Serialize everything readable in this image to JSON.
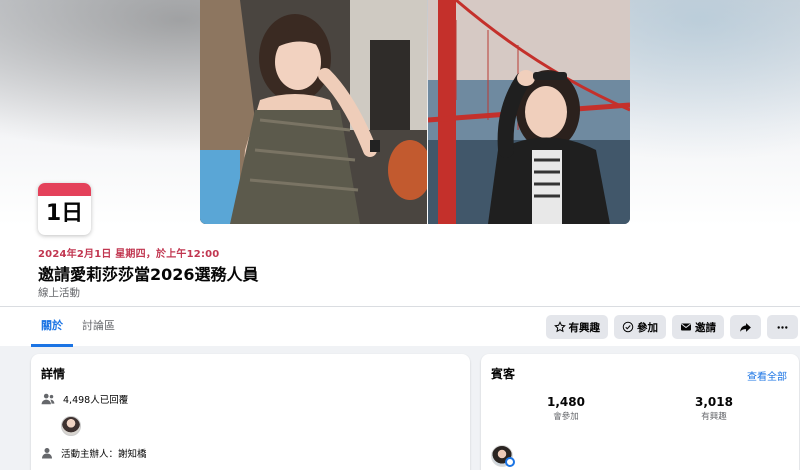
{
  "event": {
    "date_card_day": "1日",
    "datetime": "2024年2月1日 星期四，於上午12:00",
    "title": "邀請愛莉莎莎當2026選務人員",
    "type": "線上活動"
  },
  "tabs": [
    {
      "label": "關於",
      "active": true
    },
    {
      "label": "討論區",
      "active": false
    }
  ],
  "actions": {
    "interested_label": "有興趣",
    "going_label": "參加",
    "invite_label": "邀請",
    "share_icon": "share-arrow-icon",
    "more_icon": "more-dots-icon"
  },
  "details": {
    "heading": "詳情",
    "responded": "4,498人已回覆",
    "host": "活動主辦人：謝知橋"
  },
  "guests": {
    "heading": "賓客",
    "see_all": "查看全部",
    "going_count": "1,480",
    "going_label": "會參加",
    "interested_count": "3,018",
    "interested_label": "有興趣"
  },
  "colors": {
    "accent": "#1b74e4",
    "date_red": "#c13650",
    "calendar_red": "#e4415a"
  }
}
